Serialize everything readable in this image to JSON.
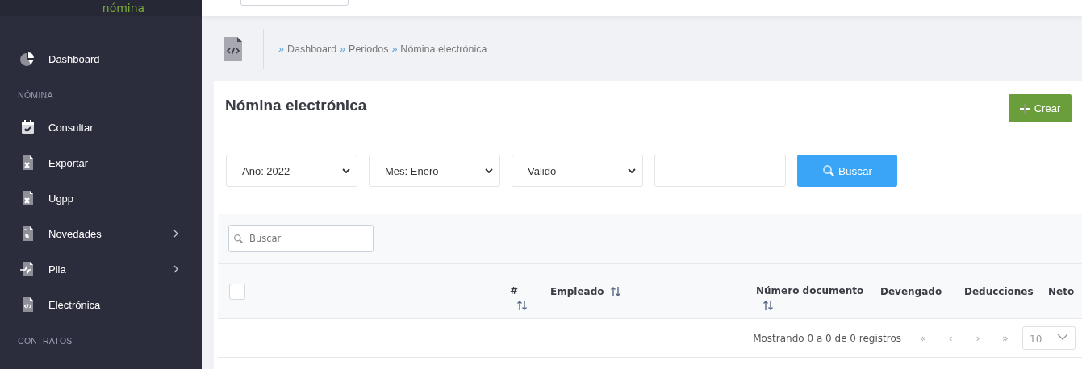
{
  "brand": {
    "logo_text": "nómina"
  },
  "sidebar": {
    "top_items": [
      {
        "label": "Dashboard",
        "kind": "pie",
        "expandable": false
      }
    ],
    "sections": [
      {
        "title": "NÓMINA",
        "items": [
          {
            "label": "Consultar",
            "kind": "calendar",
            "expandable": false
          },
          {
            "label": "Exportar",
            "kind": "excel",
            "expandable": false
          },
          {
            "label": "Ugpp",
            "kind": "excel",
            "expandable": false
          },
          {
            "label": "Novedades",
            "kind": "money",
            "expandable": true
          },
          {
            "label": "Pila",
            "kind": "pulse",
            "expandable": true
          },
          {
            "label": "Electrónica",
            "kind": "code",
            "expandable": false
          }
        ]
      },
      {
        "title": "CONTRATOS"
      }
    ]
  },
  "breadcrumb": {
    "separator": "»",
    "items": [
      "Dashboard",
      "Periodos",
      "Nómina electrónica"
    ]
  },
  "page": {
    "title": "Nómina electrónica",
    "create_button": "Crear"
  },
  "filters": [
    {
      "kind": "select",
      "value": "Año: 2022"
    },
    {
      "kind": "select",
      "value": "Mes: Enero"
    },
    {
      "kind": "select",
      "value": "Valido"
    },
    {
      "kind": "text"
    }
  ],
  "search_button": "Buscar",
  "table": {
    "search": {
      "placeholder": "Buscar"
    },
    "select_all": {
      "checked": false
    },
    "columns": [
      {
        "label": "#",
        "sortable": true
      },
      {
        "label": "Empleado",
        "sortable": true
      },
      {
        "label": "Número documento",
        "sortable": true
      },
      {
        "label": "Devengado",
        "sortable": false
      },
      {
        "label": "Deducciones",
        "sortable": false
      },
      {
        "label": "Neto",
        "sortable": false
      }
    ],
    "info": "Mostrando 0 a 0 de 0 registros",
    "pagination": [
      "«",
      "‹",
      "›",
      "»"
    ],
    "page_size": "10"
  }
}
